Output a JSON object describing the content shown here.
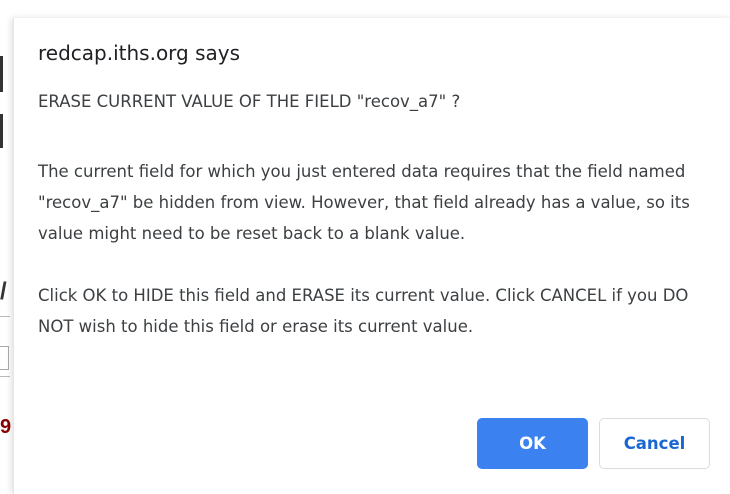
{
  "dialog": {
    "origin": "redcap.iths.org says",
    "heading": "ERASE CURRENT VALUE OF THE FIELD \"recov_a7\" ?",
    "paragraph1": "The current field for which you just entered data requires that the field named \"recov_a7\" be hidden from view. However, that field already has a value, so its value might need to be reset back to a blank value.",
    "paragraph2": "Click OK to HIDE this field and ERASE its current value. Click CANCEL if you DO NOT wish to hide this field or erase its current value.",
    "ok_label": "OK",
    "cancel_label": "Cancel"
  },
  "colors": {
    "ok_button": "#3b82f0",
    "cancel_text": "#1a66d2",
    "text": "#3c4043"
  }
}
